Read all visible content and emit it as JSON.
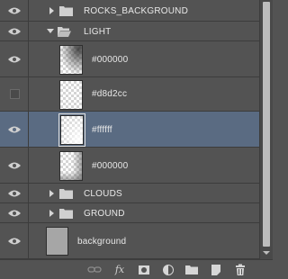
{
  "layers": [
    {
      "type": "group",
      "name": "ROCKS_BACKGROUND",
      "visible": true,
      "expanded": false,
      "icon": "folder-icon"
    },
    {
      "type": "group",
      "name": "LIGHT",
      "visible": true,
      "expanded": true,
      "icon": "folder-open-icon"
    },
    {
      "type": "layer",
      "name": "#000000",
      "visible": true,
      "selected": false,
      "thumb": "dark-gradient"
    },
    {
      "type": "layer",
      "name": "#d8d2cc",
      "visible": false,
      "selected": false,
      "thumb": "transparent"
    },
    {
      "type": "layer",
      "name": "#ffffff",
      "visible": true,
      "selected": true,
      "thumb": "light"
    },
    {
      "type": "layer",
      "name": "#000000",
      "visible": true,
      "selected": false,
      "thumb": "dark-edge"
    },
    {
      "type": "group",
      "name": "CLOUDS",
      "visible": true,
      "expanded": false,
      "icon": "folder-icon"
    },
    {
      "type": "group",
      "name": "GROUND",
      "visible": true,
      "expanded": false,
      "icon": "folder-icon"
    },
    {
      "type": "layer",
      "name": "background",
      "visible": true,
      "selected": false,
      "thumb": "gray"
    }
  ],
  "colors": {
    "panel": "#535353",
    "selected_row": "#5a6b82",
    "border": "#3c3c3c",
    "background_thumb": "#a6a6a6"
  },
  "footer": {
    "icons": [
      "link-layers-icon",
      "fx-icon",
      "add-mask-icon",
      "adjustment-layer-icon",
      "new-group-icon",
      "new-layer-icon",
      "trash-icon"
    ],
    "fx_label": "fx"
  }
}
